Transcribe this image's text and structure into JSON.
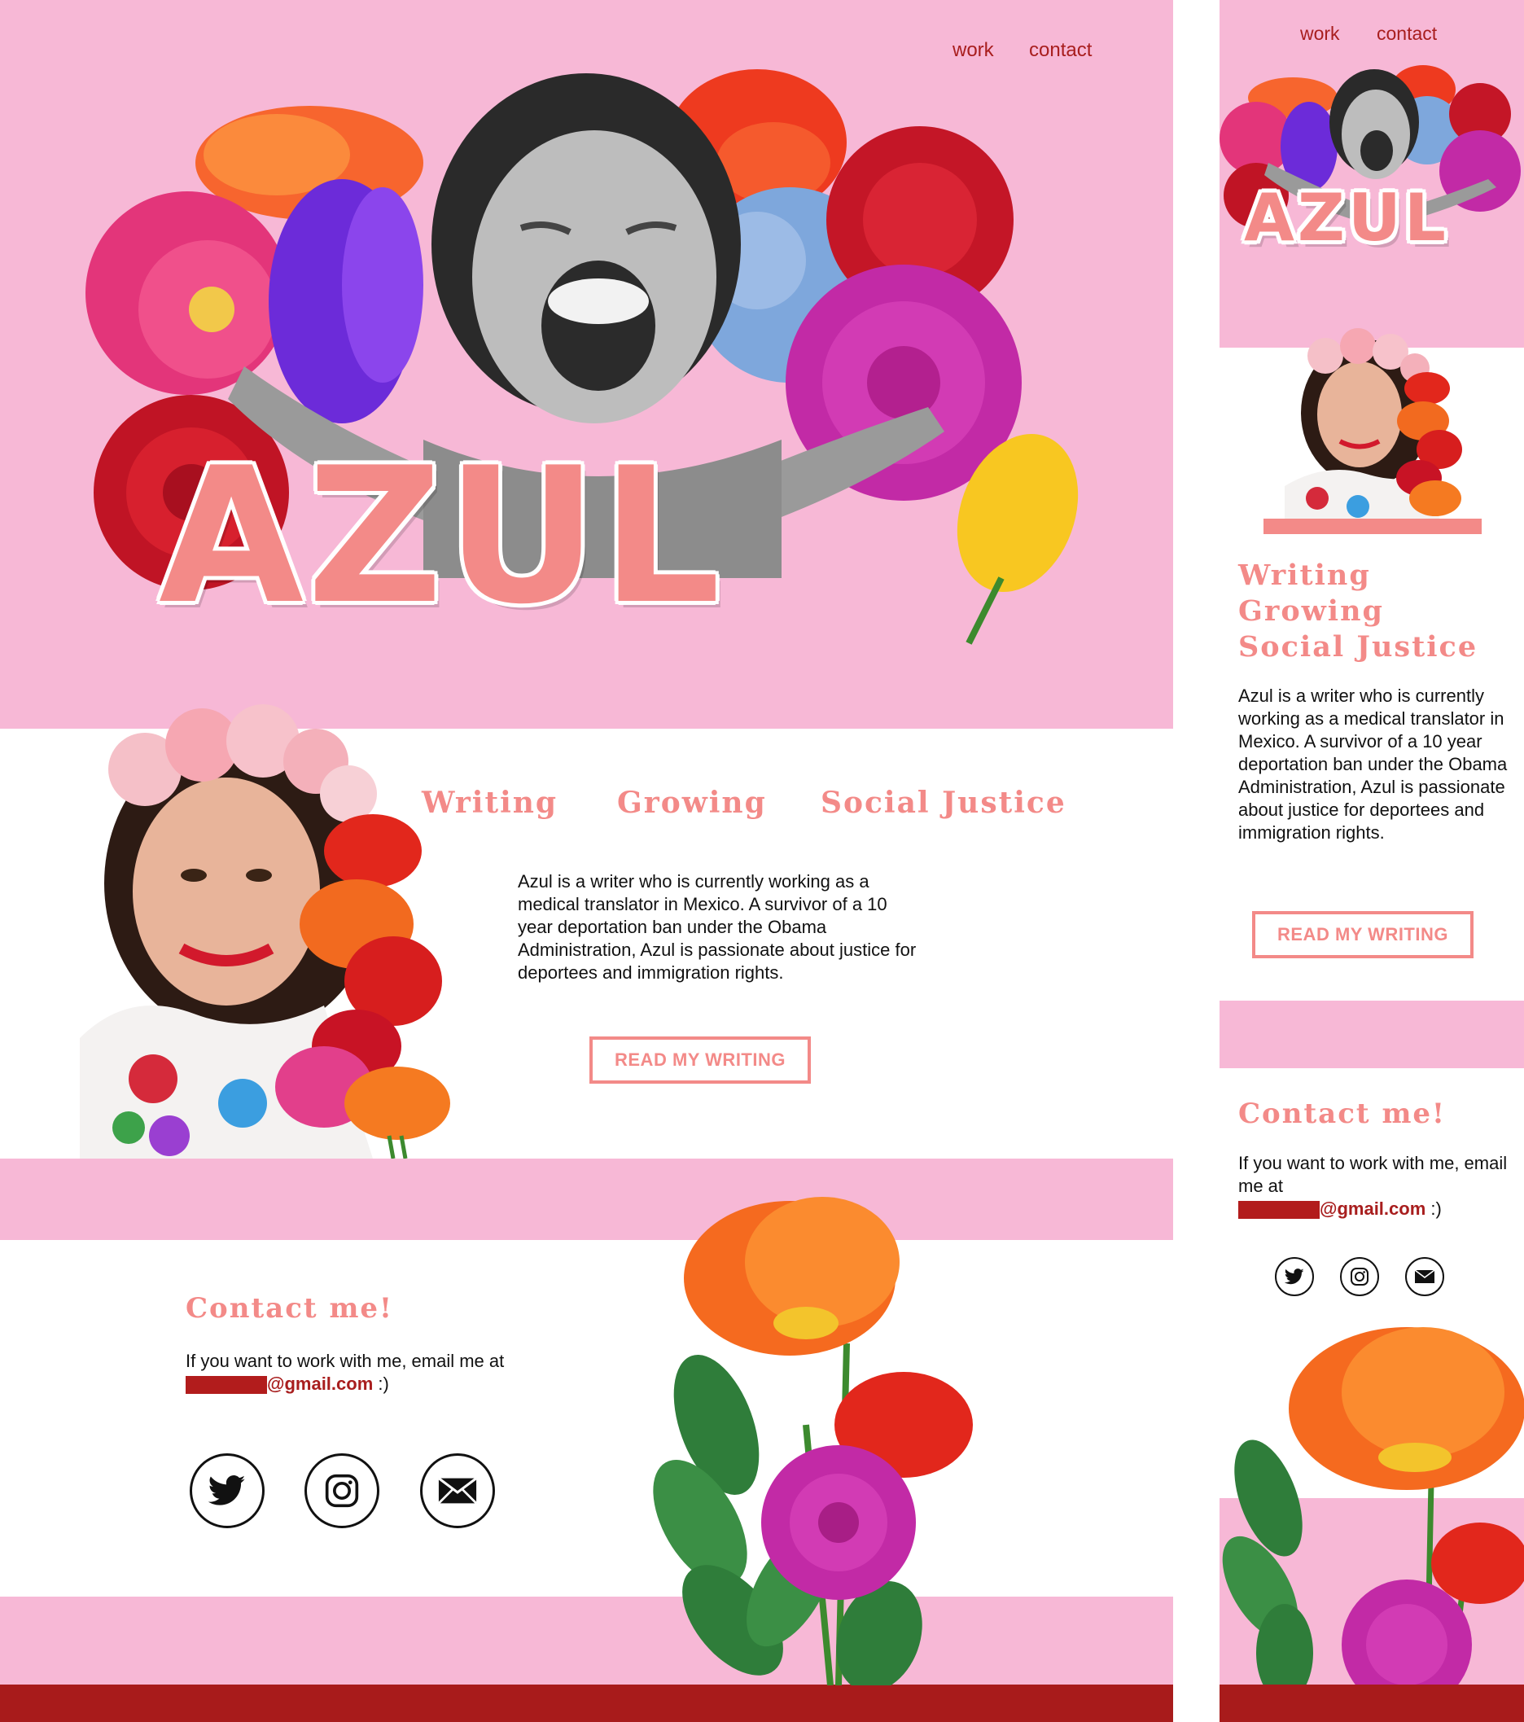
{
  "colors": {
    "pink": "#f7b8d6",
    "coral": "#f38a88",
    "dark_red": "#a81b1b",
    "white": "#ffffff"
  },
  "nav": {
    "work": "work",
    "contact": "contact"
  },
  "hero": {
    "name": "AZUL"
  },
  "about": {
    "tags": [
      "Writing",
      "Growing",
      "Social Justice"
    ],
    "bio": "Azul is a writer who is currently working as a medical translator in Mexico. A survivor of a 10 year deportation ban under the Obama Administration, Azul is passionate about justice for deportees and immigration rights.",
    "button": "READ MY WRITING"
  },
  "contact": {
    "title": "Contact me!",
    "text": "If you want to work with me, email me at",
    "email_domain": "@gmail.com",
    "email_suffix": " :)"
  },
  "social": {
    "twitter_icon": "twitter-icon",
    "instagram_icon": "instagram-icon",
    "email_icon": "mail-icon"
  }
}
